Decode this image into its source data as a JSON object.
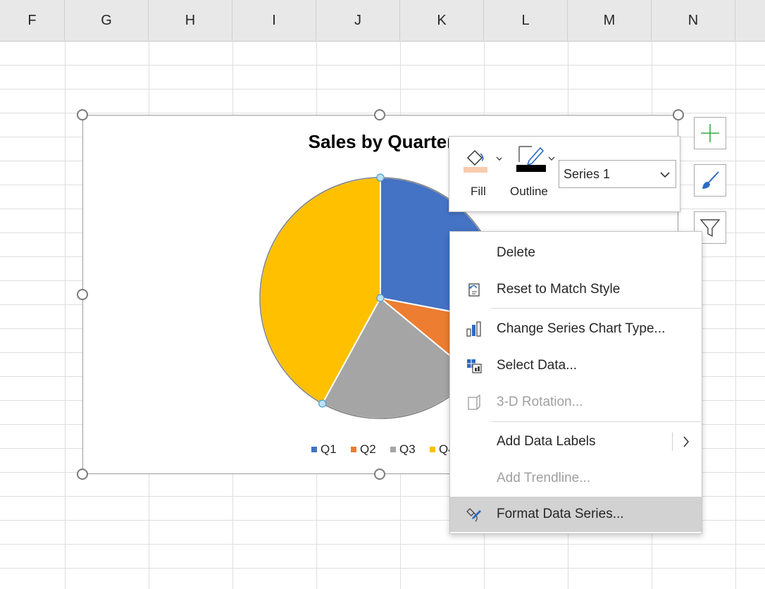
{
  "columns": [
    "F",
    "G",
    "H",
    "I",
    "J",
    "K",
    "L",
    "M",
    "N"
  ],
  "chart": {
    "title": "Sales by Quarter",
    "legend": [
      "Q1",
      "Q2",
      "Q3",
      "Q4"
    ],
    "colors": {
      "Q1": "#4472c4",
      "Q2": "#ed7d31",
      "Q3": "#a5a5a5",
      "Q4": "#ffc000"
    }
  },
  "chart_data": {
    "type": "pie",
    "title": "Sales by Quarter",
    "categories": [
      "Q1",
      "Q2",
      "Q3",
      "Q4"
    ],
    "values": [
      28,
      8,
      22,
      42
    ],
    "legend_position": "bottom"
  },
  "side_buttons": {
    "elements": "plus-icon",
    "styles": "brush-icon",
    "filters": "funnel-icon"
  },
  "mini_toolbar": {
    "fill_label": "Fill",
    "outline_label": "Outline",
    "series_value": "Series 1"
  },
  "context_menu": {
    "items": [
      {
        "label": "Delete",
        "icon": "none",
        "disabled": false
      },
      {
        "label": "Reset to Match Style",
        "icon": "reset-style-icon",
        "disabled": false
      },
      {
        "label": "Change Series Chart Type...",
        "icon": "chart-type-icon",
        "disabled": false
      },
      {
        "label": "Select Data...",
        "icon": "select-data-icon",
        "disabled": false
      },
      {
        "label": "3-D Rotation...",
        "icon": "rotation-3d-icon",
        "disabled": true
      },
      {
        "label": "Add Data Labels",
        "icon": "none",
        "disabled": false,
        "submenu": true
      },
      {
        "label": "Add Trendline...",
        "icon": "none",
        "disabled": true
      },
      {
        "label": "Format Data Series...",
        "icon": "format-series-icon",
        "disabled": false,
        "highlighted": true
      }
    ]
  }
}
